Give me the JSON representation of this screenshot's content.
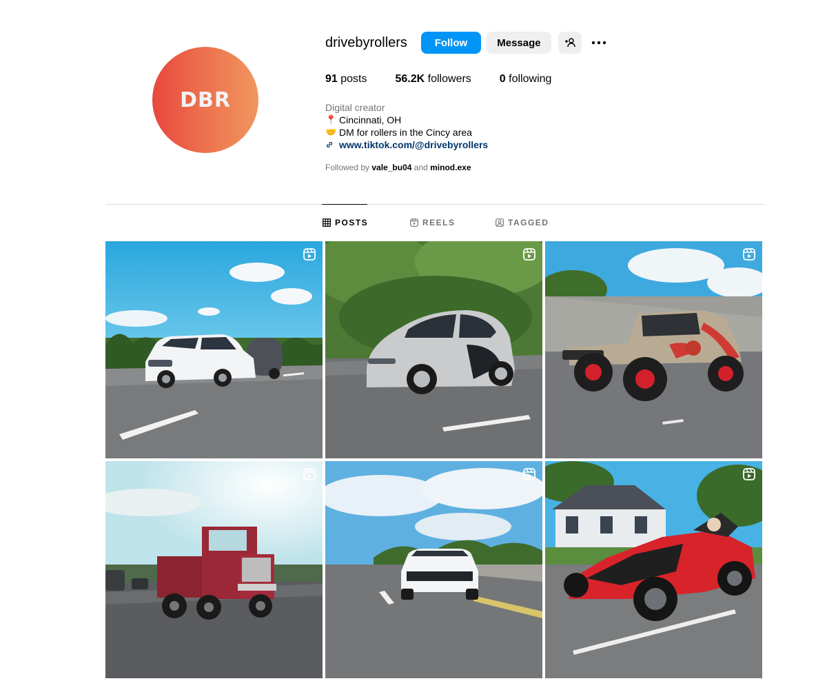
{
  "profile": {
    "avatar_text": "DBR",
    "username": "drivebyrollers",
    "follow_label": "Follow",
    "message_label": "Message",
    "stats": {
      "posts_count": "91",
      "posts_label": "posts",
      "followers_count": "56.2K",
      "followers_label": "followers",
      "following_count": "0",
      "following_label": "following"
    },
    "bio": {
      "category": "Digital creator",
      "location_emoji": "📍",
      "location": "Cincinnati, OH",
      "dm_emoji": "🤝",
      "dm_text": "DM for rollers in the Cincy area",
      "link": "www.tiktok.com/@drivebyrollers"
    },
    "followed_by": {
      "prefix": "Followed by",
      "user1": "vale_bu04",
      "and": "and",
      "user2": "minod.exe"
    }
  },
  "tabs": [
    {
      "label": "POSTS",
      "icon": "grid-icon",
      "active": true
    },
    {
      "label": "REELS",
      "icon": "reels-icon",
      "active": false
    },
    {
      "label": "TAGGED",
      "icon": "tagged-icon",
      "active": false
    }
  ],
  "posts": [
    {
      "subject": "white-suv-with-camper-trailer",
      "badge": "reel-icon"
    },
    {
      "subject": "silver-smart-car",
      "badge": "reel-icon"
    },
    {
      "subject": "jurassic-park-jeep",
      "badge": "reel-icon"
    },
    {
      "subject": "red-mack-tow-truck",
      "badge": "reel-icon"
    },
    {
      "subject": "white-cadillac-suv",
      "badge": "reel-icon"
    },
    {
      "subject": "red-polaris-slingshot",
      "badge": "reel-icon"
    }
  ],
  "colors": {
    "follow_button": "#0095f6",
    "secondary_button": "#efefef",
    "link": "#00376b",
    "muted_text": "#737373",
    "divider": "#dbdbdb"
  }
}
